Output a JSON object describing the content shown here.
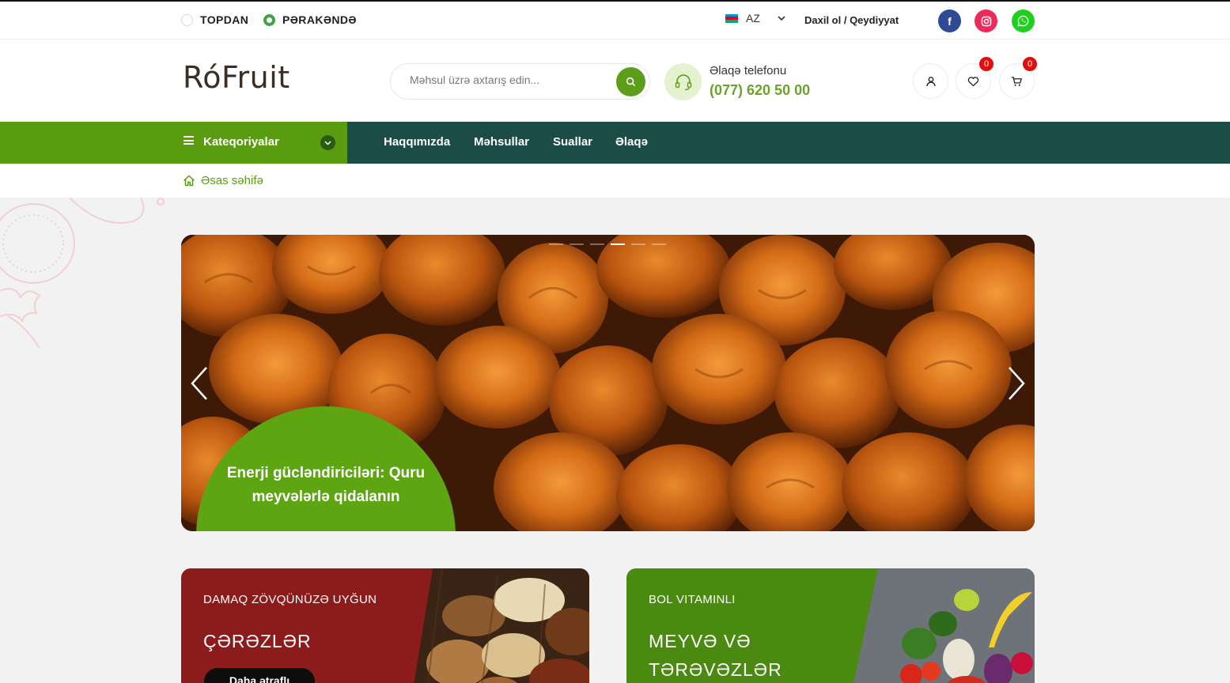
{
  "topbar": {
    "mode_wholesale": "TOPDAN",
    "mode_retail": "PƏRAKƏNDƏ",
    "language": "AZ",
    "auth_link": "Daxil ol / Qeydiyyat"
  },
  "header": {
    "logo_left": "Ró",
    "logo_right": "Fruit",
    "search_placeholder": "Məhsul üzrə axtarış edin...",
    "phone_label": "Əlaqə telefonu",
    "phone_number": "(077) 620 50 00",
    "wishlist_count": "0",
    "cart_count": "0"
  },
  "nav": {
    "categories_label": "Kateqoriyalar",
    "links": [
      "Haqqımızda",
      "Məhsullar",
      "Suallar",
      "Əlaqə"
    ]
  },
  "breadcrumb": {
    "home": "Əsas səhifə"
  },
  "hero": {
    "caption": "Enerji gücləndiriciləri: Quru meyvələrlə qidalanın",
    "slide_count": 6,
    "active_slide": 4
  },
  "cards": [
    {
      "subtitle": "DAMAQ ZÖVQÜNÜZƏ UYĞUN",
      "title": "ÇƏRƏZLƏR",
      "button": "Daha ətraflı"
    },
    {
      "subtitle": "BOL VITAMINLI",
      "title": "MEYVƏ VƏ TƏRƏVƏZLƏR"
    }
  ],
  "colors": {
    "brand_green": "#5a9c0f",
    "nav_dark": "#1b4c47",
    "accent_red": "#e40d0d",
    "card_red": "#8c1c1c",
    "card_green": "#4a8a10"
  }
}
